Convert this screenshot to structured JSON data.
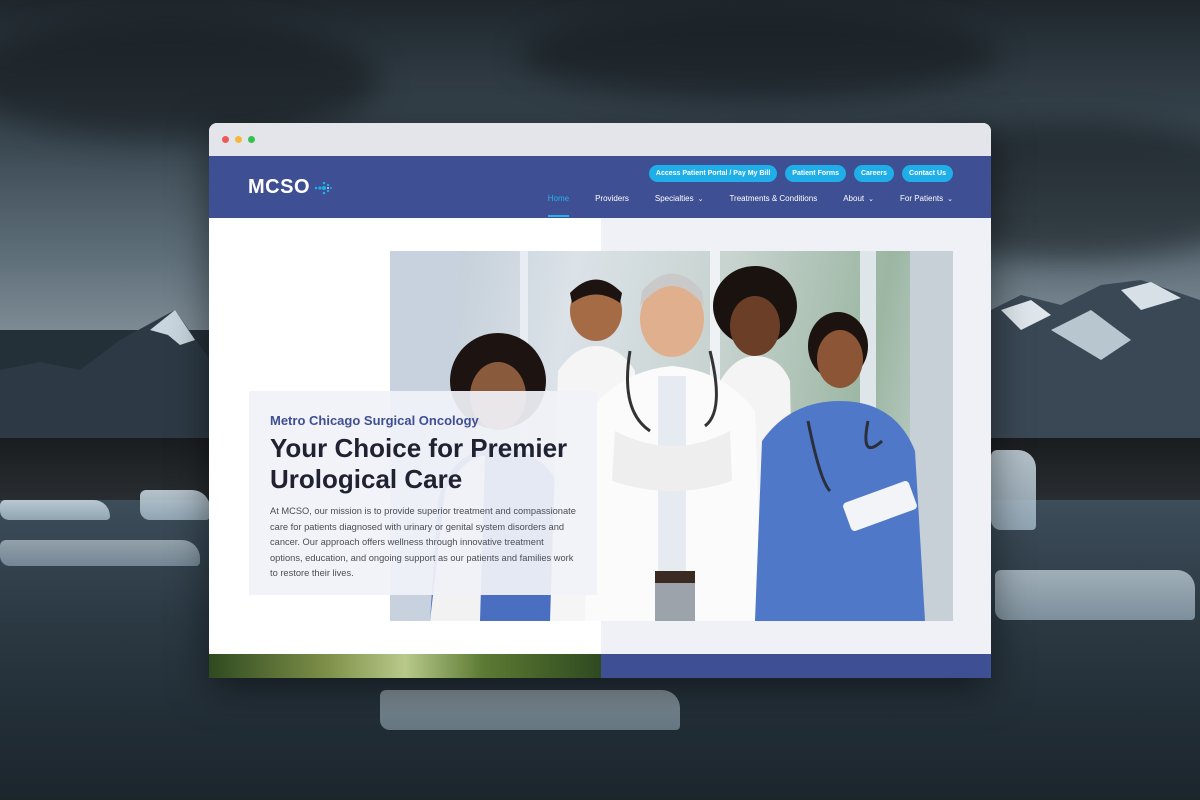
{
  "browser": {
    "window_dots": [
      "#ee5b55",
      "#f4b93c",
      "#35c24a"
    ]
  },
  "header": {
    "logo_text": "MCSO",
    "brand_color": "#3f4f93",
    "accent_color": "#1faee8",
    "utility_nav": [
      {
        "label": "Access Patient Portal / Pay My Bill"
      },
      {
        "label": "Patient Forms"
      },
      {
        "label": "Careers"
      },
      {
        "label": "Contact Us"
      }
    ],
    "main_nav": [
      {
        "label": "Home",
        "active": true,
        "dropdown": false
      },
      {
        "label": "Providers",
        "active": false,
        "dropdown": false
      },
      {
        "label": "Specialties",
        "active": false,
        "dropdown": true
      },
      {
        "label": "Treatments & Conditions",
        "active": false,
        "dropdown": false
      },
      {
        "label": "About",
        "active": false,
        "dropdown": true
      },
      {
        "label": "For Patients",
        "active": false,
        "dropdown": true
      }
    ]
  },
  "hero": {
    "eyebrow": "Metro Chicago Surgical Oncology",
    "headline": "Your Choice for Premier Urological Care",
    "body": "At MCSO, our mission is to provide superior treatment and compassionate care for patients diagnosed with urinary or genital system disorders and cancer. Our approach offers wellness through innovative treatment options, education, and ongoing support as our patients and families work to restore their lives."
  }
}
